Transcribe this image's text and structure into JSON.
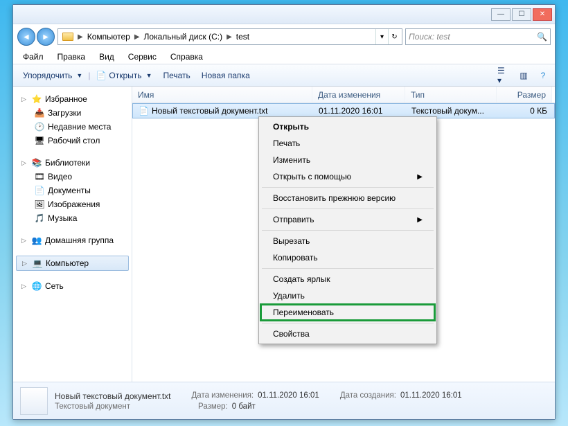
{
  "titlebar": {
    "min": "—",
    "max": "☐",
    "close": "✕"
  },
  "nav": {
    "breadcrumb": [
      "Компьютер",
      "Локальный диск (C:)",
      "test"
    ],
    "search_placeholder": "Поиск: test"
  },
  "menu": [
    "Файл",
    "Правка",
    "Вид",
    "Сервис",
    "Справка"
  ],
  "toolbar": {
    "organize": "Упорядочить",
    "open": "Открыть",
    "print": "Печать",
    "new_folder": "Новая папка"
  },
  "sidebar": {
    "favorites": {
      "label": "Избранное",
      "items": [
        "Загрузки",
        "Недавние места",
        "Рабочий стол"
      ]
    },
    "libraries": {
      "label": "Библиотеки",
      "items": [
        "Видео",
        "Документы",
        "Изображения",
        "Музыка"
      ]
    },
    "homegroup": "Домашняя группа",
    "computer": "Компьютер",
    "network": "Сеть"
  },
  "list": {
    "headers": {
      "name": "Имя",
      "date": "Дата изменения",
      "type": "Тип",
      "size": "Размер"
    },
    "row": {
      "name": "Новый текстовый документ.txt",
      "date": "01.11.2020 16:01",
      "type": "Текстовый докум...",
      "size": "0 КБ"
    }
  },
  "context": {
    "open": "Открыть",
    "print": "Печать",
    "edit": "Изменить",
    "open_with": "Открыть с помощью",
    "restore": "Восстановить прежнюю версию",
    "send_to": "Отправить",
    "cut": "Вырезать",
    "copy": "Копировать",
    "shortcut": "Создать ярлык",
    "delete": "Удалить",
    "rename": "Переименовать",
    "properties": "Свойства"
  },
  "status": {
    "title": "Новый текстовый документ.txt",
    "subtitle": "Текстовый документ",
    "date_mod_lbl": "Дата изменения:",
    "date_mod": "01.11.2020 16:01",
    "size_lbl": "Размер:",
    "size": "0 байт",
    "date_created_lbl": "Дата создания:",
    "date_created": "01.11.2020 16:01"
  }
}
